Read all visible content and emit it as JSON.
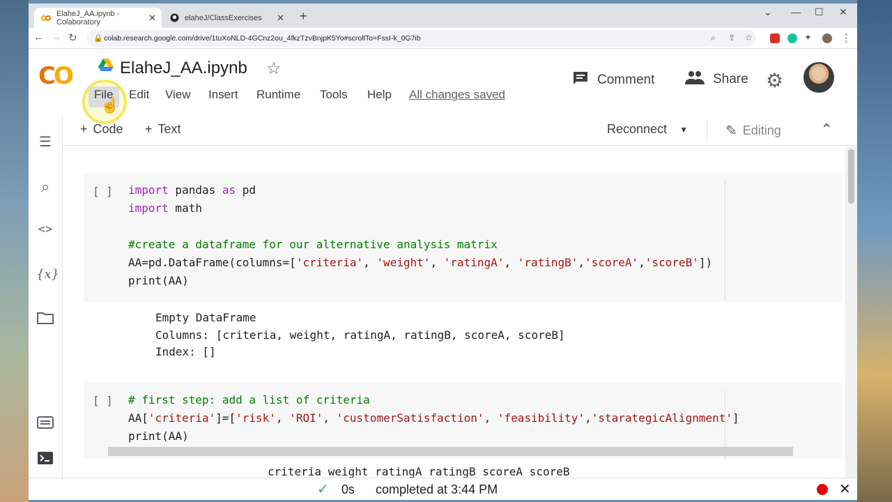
{
  "browser": {
    "tabs": [
      {
        "title": "ElaheJ_AA.ipynb - Colaboratory",
        "active": true
      },
      {
        "title": "elaheJ/ClassExercises",
        "active": false
      }
    ],
    "url": "colab.research.google.com/drive/1tuXoNLD-4GCnz2ou_4fkzTzvBnjpK5Yo#scrollTo=FssI-k_0G7ib"
  },
  "colab": {
    "logo": "CO",
    "notebook_title": "ElaheJ_AA.ipynb",
    "menu": [
      "File",
      "Edit",
      "View",
      "Insert",
      "Runtime",
      "Tools",
      "Help"
    ],
    "save_status": "All changes saved",
    "comment_label": "Comment",
    "share_label": "Share",
    "toolbar": {
      "code_label": "Code",
      "text_label": "Text",
      "reconnect_label": "Reconnect",
      "editing_label": "Editing"
    }
  },
  "cells": [
    {
      "run_bracket": "[ ]",
      "output": [
        "Empty DataFrame",
        "Columns: [criteria, weight, ratingA, ratingB, scoreA, scoreB]",
        "Index: []"
      ]
    },
    {
      "run_bracket": "[ ]",
      "output": [
        "criteria weight ratingA ratingB scoreA scoreB"
      ]
    }
  ],
  "status_bar": {
    "duration": "0s",
    "completed_text": "completed at 3:44 PM"
  },
  "colors": {
    "logo_orange": "#f9ab00",
    "logo_orange_dark": "#e8710a",
    "keyword": "#9c27b0",
    "string": "#a31515",
    "comment": "#008000",
    "cursor_highlight": "#f5e85c",
    "status_ok": "#34a853",
    "record_red": "#e60000"
  },
  "icons": [
    "colab-icon",
    "github-icon",
    "drive-icon",
    "star-icon",
    "comment-icon",
    "share-people-icon",
    "gear-icon",
    "toc-icon",
    "search-icon",
    "code-snippets-icon",
    "variables-icon",
    "folder-icon",
    "command-palette-icon",
    "terminal-icon",
    "check-icon",
    "pencil-icon",
    "chevron-up-icon",
    "caret-down-icon"
  ]
}
